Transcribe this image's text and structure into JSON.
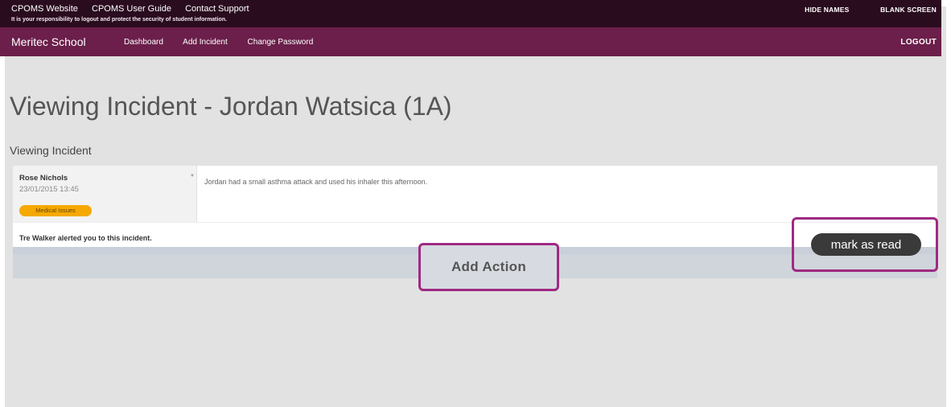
{
  "topbar": {
    "links": [
      "CPOMS Website",
      "CPOMS User Guide",
      "Contact Support"
    ],
    "notice": "It is your responsibility to logout and protect the security of student information.",
    "hide_names": "HIDE NAMES",
    "blank_screen": "BLANK SCREEN"
  },
  "navbar": {
    "brand": "Meritec School",
    "links": [
      "Dashboard",
      "Add Incident",
      "Change Password"
    ],
    "logout": "LOGOUT"
  },
  "main": {
    "title": "Viewing Incident - Jordan Watsica (1A)",
    "subtitle": "Viewing Incident"
  },
  "incident": {
    "author": "Rose Nichols",
    "datetime": "23/01/2015 13:45",
    "category": "Medical Issues",
    "text": "Jordan had a small asthma attack and used his inhaler this afternoon.",
    "alert": "Tre Walker alerted you to this incident."
  },
  "actions": {
    "add_action": "Add Action",
    "mark_as_read": "mark as read"
  },
  "colors": {
    "topbar": "#2a0c1f",
    "navbar": "#6b1f4a",
    "badge": "#f5a900",
    "highlight": "#9e2a82"
  }
}
